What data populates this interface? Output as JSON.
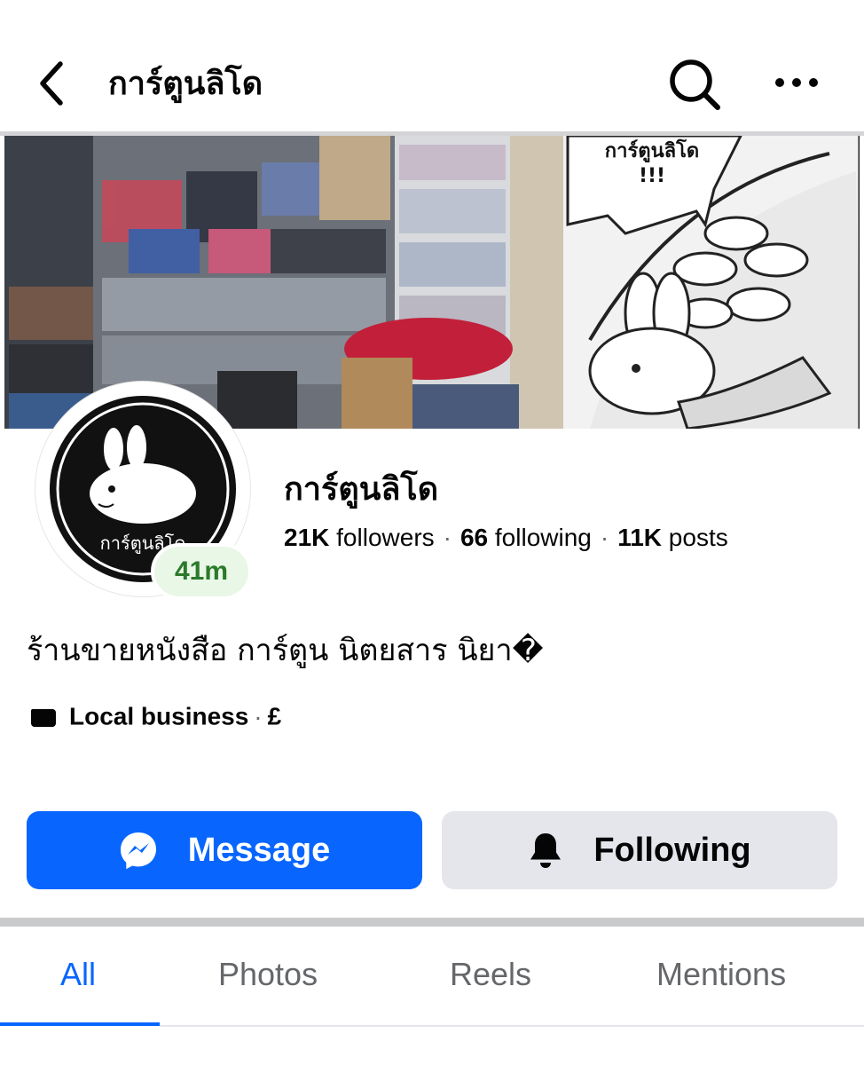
{
  "header": {
    "back_icon": "chevron-left-icon",
    "title": "การ์ตูนลิโด",
    "search_icon": "search-icon",
    "more_icon": "more-horizontal-icon"
  },
  "cover": {
    "speech_text_line1": "การ์ตูนลิโด",
    "speech_text_line2": "!!!"
  },
  "avatar": {
    "label": "การ์ตูนลิโด",
    "active_badge": "41m"
  },
  "profile": {
    "name": "การ์ตูนลิโด",
    "followers_count": "21K",
    "followers_label": "followers",
    "following_count": "66",
    "following_label": "following",
    "posts_count": "11K",
    "posts_label": "posts",
    "bio": "ร้านขายหนังสือ การ์ตูน นิตยสาร นิยา�",
    "category": "Local business",
    "price": "£"
  },
  "actions": {
    "message_label": "Message",
    "following_label": "Following"
  },
  "tabs": [
    "All",
    "Photos",
    "Reels",
    "Mentions"
  ],
  "colors": {
    "brand_blue": "#0866ff",
    "secondary_button": "#e4e6eb",
    "active_badge_bg": "#e9f7e6",
    "active_badge_text": "#2a7a2a"
  }
}
